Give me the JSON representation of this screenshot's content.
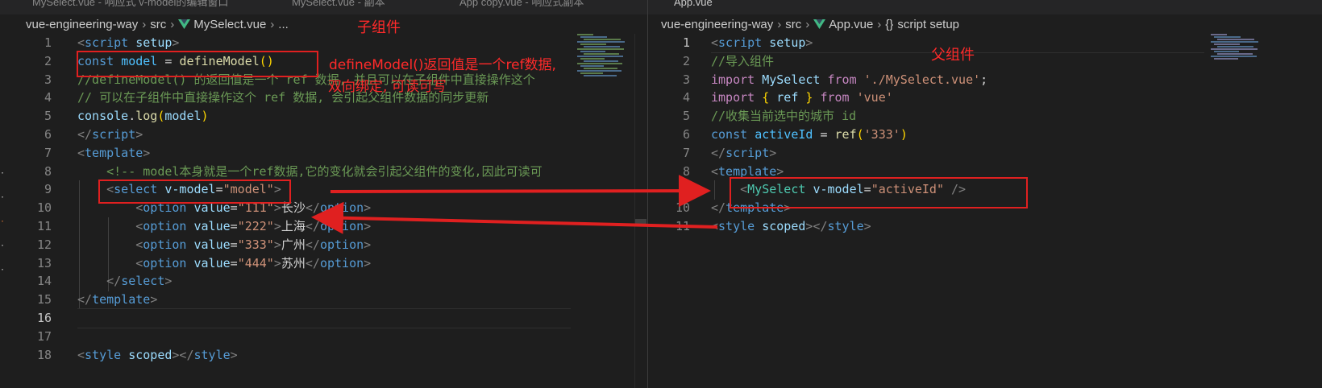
{
  "left": {
    "tabs": [
      {
        "label": "MySelect.vue - 响应式 v-model的编辑窗口"
      },
      {
        "label": "MySelect.vue - 副本"
      },
      {
        "label": "App copy.vue - 响应式副本"
      }
    ],
    "breadcrumb": {
      "root": "vue-engineering-way",
      "folder": "src",
      "file": "MySelect.vue",
      "more": "..."
    },
    "lines": [
      [
        [
          "tag",
          "<"
        ],
        [
          "tname",
          "script"
        ],
        [
          "p",
          " "
        ],
        [
          "attr",
          "setup"
        ],
        [
          "tag",
          ">"
        ]
      ],
      [
        [
          "kw",
          "const"
        ],
        [
          "p",
          " "
        ],
        [
          "var",
          "model"
        ],
        [
          "p",
          " = "
        ],
        [
          "fn",
          "defineModel"
        ],
        [
          "br",
          "()"
        ]
      ],
      [
        [
          "com",
          "//defineModel() 的返回值是一个 ref 数据, 并且可以在子组件中直接操作这个"
        ]
      ],
      [
        [
          "com",
          "// 可以在子组件中直接操作这个 ref 数据, 会引起父组件数据的同步更新"
        ]
      ],
      [
        [
          "var2",
          "console"
        ],
        [
          "p",
          "."
        ],
        [
          "fn",
          "log"
        ],
        [
          "br",
          "("
        ],
        [
          "var2",
          "model"
        ],
        [
          "br",
          ")"
        ]
      ],
      [
        [
          "tag",
          "</"
        ],
        [
          "tname",
          "script"
        ],
        [
          "tag",
          ">"
        ]
      ],
      [
        [
          "tag",
          "<"
        ],
        [
          "tname",
          "template"
        ],
        [
          "tag",
          ">"
        ]
      ],
      [
        [
          "p",
          "    "
        ],
        [
          "com",
          "<!-- model本身就是一个ref数据,它的变化就会引起父组件的变化,因此可读可"
        ]
      ],
      [
        [
          "p",
          "    "
        ],
        [
          "tag",
          "<"
        ],
        [
          "tname",
          "select"
        ],
        [
          "p",
          " "
        ],
        [
          "attr",
          "v-model"
        ],
        [
          "p",
          "="
        ],
        [
          "str",
          "\"model\""
        ],
        [
          "tag",
          ">"
        ]
      ],
      [
        [
          "p",
          "        "
        ],
        [
          "tag",
          "<"
        ],
        [
          "tname",
          "option"
        ],
        [
          "p",
          " "
        ],
        [
          "attr",
          "value"
        ],
        [
          "p",
          "="
        ],
        [
          "str",
          "\"111\""
        ],
        [
          "tag",
          ">"
        ],
        [
          "txt",
          "长沙"
        ],
        [
          "tag",
          "</"
        ],
        [
          "tname",
          "option"
        ],
        [
          "tag",
          ">"
        ]
      ],
      [
        [
          "p",
          "        "
        ],
        [
          "tag",
          "<"
        ],
        [
          "tname",
          "option"
        ],
        [
          "p",
          " "
        ],
        [
          "attr",
          "value"
        ],
        [
          "p",
          "="
        ],
        [
          "str",
          "\"222\""
        ],
        [
          "tag",
          ">"
        ],
        [
          "txt",
          "上海"
        ],
        [
          "tag",
          "</"
        ],
        [
          "tname",
          "option"
        ],
        [
          "tag",
          ">"
        ]
      ],
      [
        [
          "p",
          "        "
        ],
        [
          "tag",
          "<"
        ],
        [
          "tname",
          "option"
        ],
        [
          "p",
          " "
        ],
        [
          "attr",
          "value"
        ],
        [
          "p",
          "="
        ],
        [
          "str",
          "\"333\""
        ],
        [
          "tag",
          ">"
        ],
        [
          "txt",
          "广州"
        ],
        [
          "tag",
          "</"
        ],
        [
          "tname",
          "option"
        ],
        [
          "tag",
          ">"
        ]
      ],
      [
        [
          "p",
          "        "
        ],
        [
          "tag",
          "<"
        ],
        [
          "tname",
          "option"
        ],
        [
          "p",
          " "
        ],
        [
          "attr",
          "value"
        ],
        [
          "p",
          "="
        ],
        [
          "str",
          "\"444\""
        ],
        [
          "tag",
          ">"
        ],
        [
          "txt",
          "苏州"
        ],
        [
          "tag",
          "</"
        ],
        [
          "tname",
          "option"
        ],
        [
          "tag",
          ">"
        ]
      ],
      [
        [
          "p",
          "    "
        ],
        [
          "tag",
          "</"
        ],
        [
          "tname",
          "select"
        ],
        [
          "tag",
          ">"
        ]
      ],
      [
        [
          "tag",
          "</"
        ],
        [
          "tname",
          "template"
        ],
        [
          "tag",
          ">"
        ]
      ],
      [],
      [],
      [
        [
          "tag",
          "<"
        ],
        [
          "tname",
          "style"
        ],
        [
          "p",
          " "
        ],
        [
          "attr",
          "scoped"
        ],
        [
          "tag",
          "></"
        ],
        [
          "tname",
          "style"
        ],
        [
          "tag",
          ">"
        ]
      ]
    ],
    "line_numbers": [
      "1",
      "2",
      "3",
      "4",
      "5",
      "6",
      "7",
      "8",
      "9",
      "10",
      "11",
      "12",
      "13",
      "14",
      "15",
      "16",
      "17",
      "18"
    ],
    "active_line": "16"
  },
  "right": {
    "tabs": [
      {
        "label": "App.vue"
      }
    ],
    "breadcrumb": {
      "root": "vue-engineering-way",
      "folder": "src",
      "file": "App.vue",
      "braces": "{}",
      "symbol": "script setup"
    },
    "lines": [
      [
        [
          "tag",
          "<"
        ],
        [
          "tname",
          "script"
        ],
        [
          "p",
          " "
        ],
        [
          "attr",
          "setup"
        ],
        [
          "tag",
          ">"
        ]
      ],
      [
        [
          "com",
          "//导入组件"
        ]
      ],
      [
        [
          "kw2",
          "import"
        ],
        [
          "p",
          " "
        ],
        [
          "var2",
          "MySelect"
        ],
        [
          "p",
          " "
        ],
        [
          "kw2",
          "from"
        ],
        [
          "p",
          " "
        ],
        [
          "str",
          "'./MySelect.vue'"
        ],
        [
          "p",
          ";"
        ]
      ],
      [
        [
          "kw2",
          "import"
        ],
        [
          "p",
          " "
        ],
        [
          "br",
          "{"
        ],
        [
          "p",
          " "
        ],
        [
          "var2",
          "ref"
        ],
        [
          "p",
          " "
        ],
        [
          "br",
          "}"
        ],
        [
          "p",
          " "
        ],
        [
          "kw2",
          "from"
        ],
        [
          "p",
          " "
        ],
        [
          "str",
          "'vue'"
        ]
      ],
      [
        [
          "com",
          "//收集当前选中的城市 id"
        ]
      ],
      [
        [
          "kw",
          "const"
        ],
        [
          "p",
          " "
        ],
        [
          "var",
          "activeId"
        ],
        [
          "p",
          " = "
        ],
        [
          "fn",
          "ref"
        ],
        [
          "br",
          "("
        ],
        [
          "str",
          "'333'"
        ],
        [
          "br",
          ")"
        ]
      ],
      [
        [
          "tag",
          "</"
        ],
        [
          "tname",
          "script"
        ],
        [
          "tag",
          ">"
        ]
      ],
      [
        [
          "tag",
          "<"
        ],
        [
          "tname",
          "template"
        ],
        [
          "tag",
          ">"
        ]
      ],
      [
        [
          "p",
          "    "
        ],
        [
          "tag",
          "<"
        ],
        [
          "comp",
          "MySelect"
        ],
        [
          "p",
          " "
        ],
        [
          "attr",
          "v-model"
        ],
        [
          "p",
          "="
        ],
        [
          "str",
          "\"activeId\""
        ],
        [
          "p",
          " "
        ],
        [
          "tag",
          "/>"
        ]
      ],
      [
        [
          "tag",
          "</"
        ],
        [
          "tname",
          "template"
        ],
        [
          "tag",
          ">"
        ]
      ],
      [
        [
          "tag",
          "<"
        ],
        [
          "tname",
          "style"
        ],
        [
          "p",
          " "
        ],
        [
          "attr",
          "scoped"
        ],
        [
          "tag",
          "></"
        ],
        [
          "tname",
          "style"
        ],
        [
          "tag",
          ">"
        ]
      ]
    ],
    "line_numbers": [
      "1",
      "2",
      "3",
      "4",
      "5",
      "6",
      "7",
      "8",
      "9",
      "10",
      "11"
    ],
    "active_line": "1"
  },
  "annotations": {
    "child_component": "子组件",
    "parent_component": "父组件",
    "define_model_note_line1": "defineModel()返回值是一个ref数据,",
    "define_model_note_line2": "双向绑定, 可读可写"
  },
  "colors": {
    "annotation": "#e02020",
    "background": "#1e1e1e",
    "comment": "#6a9955"
  }
}
